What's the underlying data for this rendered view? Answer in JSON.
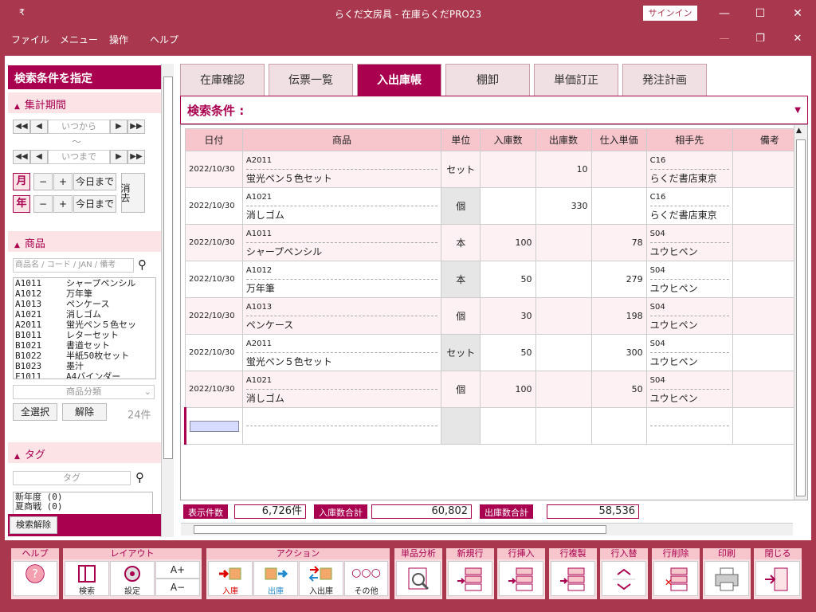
{
  "titlebar": {
    "title": "らくだ文房具 ‐ 在庫らくだPRO23",
    "signin": "サインイン",
    "qa": "₹"
  },
  "menu": [
    "ファイル",
    "メニュー",
    "操作",
    "ヘルプ"
  ],
  "left": {
    "header": "検索条件を指定",
    "period": {
      "title": "集計期間",
      "from_placeholder": "いつから",
      "tilde": "～",
      "to_placeholder": "いつまで",
      "month": "月",
      "year": "年",
      "minus": "−",
      "plus": "+",
      "today": "今日まで",
      "clear": "消去"
    },
    "product": {
      "title": "商品",
      "search_placeholder": "商品名 / コード / JAN / 備考",
      "items": [
        {
          "code": "A1011",
          "name": "シャープペンシル"
        },
        {
          "code": "A1012",
          "name": "万年筆"
        },
        {
          "code": "A1013",
          "name": "ペンケース"
        },
        {
          "code": "A1021",
          "name": "消しゴム"
        },
        {
          "code": "A2011",
          "name": "蛍光ペン５色セッ"
        },
        {
          "code": "B1011",
          "name": "レターセット"
        },
        {
          "code": "B1021",
          "name": "書道セット"
        },
        {
          "code": "B1022",
          "name": "半紙50枚セット"
        },
        {
          "code": "B1023",
          "name": "墨汁"
        },
        {
          "code": "F1011",
          "name": "A4バインダー"
        }
      ],
      "category_placeholder": "商品分類",
      "select_all": "全選択",
      "release": "解除",
      "count": "24件"
    },
    "tag": {
      "title": "タグ",
      "placeholder": "タグ",
      "items": [
        "新年度 (0)",
        "夏商戦 (0)"
      ]
    },
    "footer_button": "検索解除"
  },
  "tabs": [
    "在庫確認",
    "伝票一覧",
    "入出庫帳",
    "棚卸",
    "単価訂正",
    "発注計画"
  ],
  "active_tab": "入出庫帳",
  "search_condition": "検索条件 :",
  "grid": {
    "headers": [
      "日付",
      "商品",
      "単位",
      "入庫数",
      "出庫数",
      "仕入単価",
      "相手先",
      "備考"
    ],
    "rows": [
      {
        "date": "2022/10/30",
        "code": "A2011",
        "name": "蛍光ペン５色セット",
        "unit": "セット",
        "in": "",
        "out": "10",
        "price": "",
        "pcode": "C16",
        "partner": "らくだ書店東京"
      },
      {
        "date": "2022/10/30",
        "code": "A1021",
        "name": "消しゴム",
        "unit": "個",
        "in": "",
        "out": "330",
        "price": "",
        "pcode": "C16",
        "partner": "らくだ書店東京"
      },
      {
        "date": "2022/10/30",
        "code": "A1011",
        "name": "シャープペンシル",
        "unit": "本",
        "in": "100",
        "out": "",
        "price": "78",
        "pcode": "S04",
        "partner": "ユウヒペン"
      },
      {
        "date": "2022/10/30",
        "code": "A1012",
        "name": "万年筆",
        "unit": "本",
        "in": "50",
        "out": "",
        "price": "279",
        "pcode": "S04",
        "partner": "ユウヒペン"
      },
      {
        "date": "2022/10/30",
        "code": "A1013",
        "name": "ペンケース",
        "unit": "個",
        "in": "30",
        "out": "",
        "price": "198",
        "pcode": "S04",
        "partner": "ユウヒペン"
      },
      {
        "date": "2022/10/30",
        "code": "A2011",
        "name": "蛍光ペン５色セット",
        "unit": "セット",
        "in": "50",
        "out": "",
        "price": "300",
        "pcode": "S04",
        "partner": "ユウヒペン"
      },
      {
        "date": "2022/10/30",
        "code": "A1021",
        "name": "消しゴム",
        "unit": "個",
        "in": "100",
        "out": "",
        "price": "50",
        "pcode": "S04",
        "partner": "ユウヒペン"
      }
    ]
  },
  "totals": {
    "count_label": "表示件数",
    "count_value": "6,726件",
    "in_label": "入庫数合計",
    "in_value": "60,802",
    "out_label": "出庫数合計",
    "out_value": "58,536"
  },
  "toolbar": {
    "help": "ヘルプ",
    "layout": "レイアウト",
    "search": "検索",
    "settings": "設定",
    "font_up": "A+",
    "font_down": "A−",
    "action": "アクション",
    "in": "入庫",
    "out": "出庫",
    "inout": "入出庫",
    "other": "その他",
    "analysis": "単品分析",
    "new_row": "新規行",
    "insert_row": "行挿入",
    "copy_row": "行複製",
    "swap_row": "行入替",
    "delete_row": "行削除",
    "print": "印刷",
    "close": "閉じる"
  },
  "colors": {
    "accent": "#a9004f",
    "frame": "#a9374e",
    "header_pink": "#f7c5cc"
  }
}
